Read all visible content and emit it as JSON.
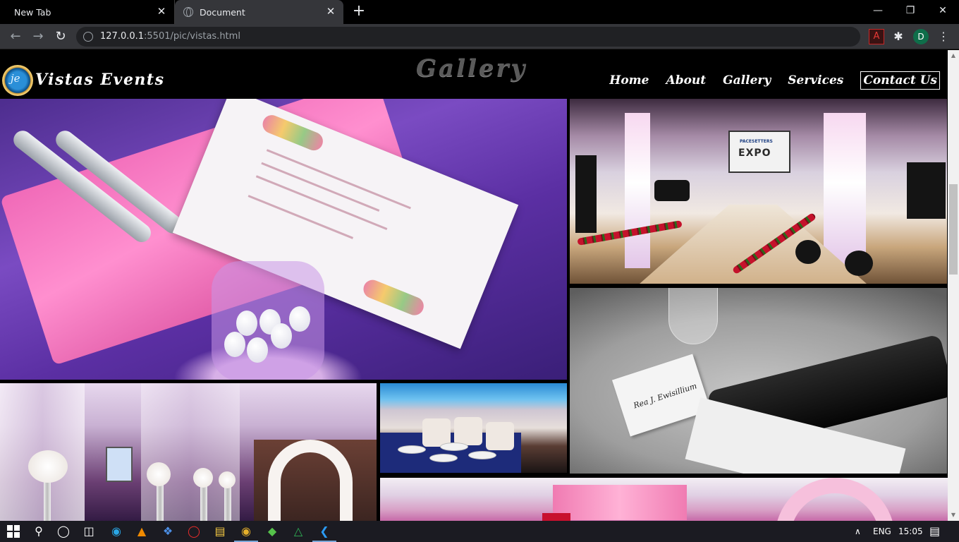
{
  "browser": {
    "tabs": [
      {
        "title": "New Tab",
        "active": false
      },
      {
        "title": "Document",
        "active": true
      }
    ],
    "new_tab_symbol": "+",
    "close_symbol": "✕",
    "window_controls": {
      "minimize": "—",
      "restore": "❐",
      "close": "✕"
    },
    "nav": {
      "back": "←",
      "forward": "→",
      "reload": "↻"
    },
    "address": {
      "host": "127.0.0.1",
      "rest": ":5501/pic/vistas.html"
    },
    "extensions": {
      "pdf": "A",
      "puzzle": "✱"
    },
    "profile_initial": "D",
    "menu_symbol": "⋮"
  },
  "site": {
    "brand": "Vistas Events",
    "logo_mark": "je",
    "page_heading": "Gallery",
    "nav": [
      {
        "label": "Home"
      },
      {
        "label": "About"
      },
      {
        "label": "Gallery"
      },
      {
        "label": "Services"
      },
      {
        "label": "Contact Us"
      }
    ],
    "gallery": [
      {
        "subject": "pink napkin table setting with menu card"
      },
      {
        "subject": "expo runway stage",
        "screen_text": "EXPO",
        "screen_small": "PACESETTERS"
      },
      {
        "subject": "black and white place card setting",
        "place_card_text": "Rea J. Ewisillium"
      },
      {
        "subject": "decorated hall with flower arch"
      },
      {
        "subject": "dining tables with blue lighting"
      },
      {
        "subject": "pink floral reception stage"
      }
    ]
  },
  "taskbar": {
    "apps": [
      "start-icon",
      "search-icon",
      "cortana-icon",
      "task-view-icon",
      "edge-icon",
      "vlc-icon",
      "dropbox-icon",
      "opera-icon",
      "file-explorer-icon",
      "chrome-icon",
      "git-icon",
      "google-drive-icon",
      "vscode-icon"
    ],
    "language": "ENG",
    "time": "15:05",
    "chevron": "∧",
    "notification_symbol": "▤"
  },
  "colors": {
    "chrome_dark": "#35363a",
    "tab_bar": "#000000",
    "omnibox": "#202124",
    "site_bg": "#000000",
    "heading_gray": "#5a5a5a",
    "taskbar": "#1b1b22"
  }
}
